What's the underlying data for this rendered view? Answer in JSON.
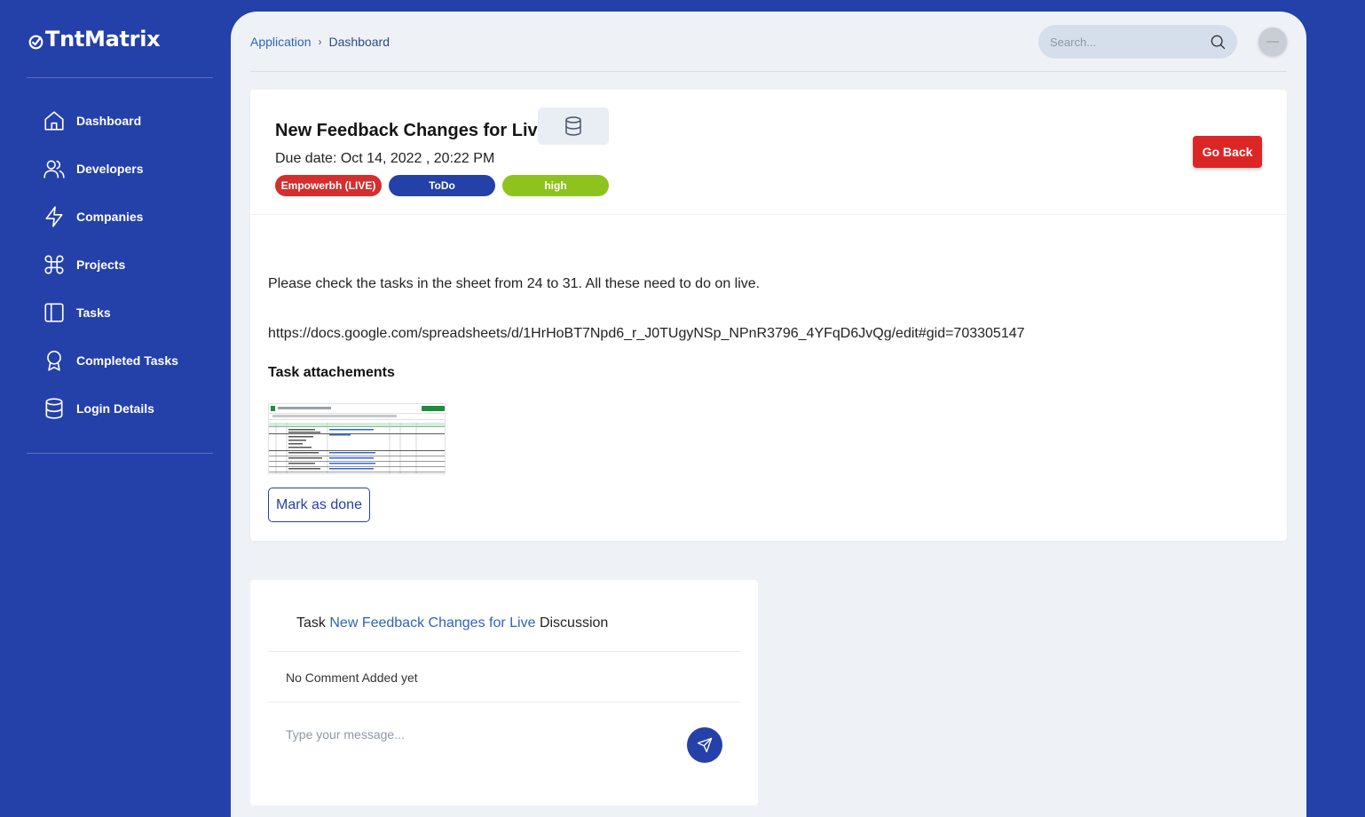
{
  "app": {
    "name": "TntMatrix"
  },
  "sidebar": {
    "items": [
      {
        "label": "Dashboard",
        "icon": "home-icon"
      },
      {
        "label": "Developers",
        "icon": "users-icon"
      },
      {
        "label": "Companies",
        "icon": "lightning-icon"
      },
      {
        "label": "Projects",
        "icon": "command-icon"
      },
      {
        "label": "Tasks",
        "icon": "columns-icon"
      },
      {
        "label": "Completed Tasks",
        "icon": "award-icon"
      },
      {
        "label": "Login Details",
        "icon": "database-icon"
      }
    ]
  },
  "header": {
    "breadcrumb": {
      "root": "Application",
      "separator": "›",
      "current": "Dashboard"
    },
    "search": {
      "placeholder": "Search..."
    }
  },
  "task": {
    "title": "New Feedback Changes for Live",
    "due_date": "Due date: Oct 14, 2022 , 20:22 PM",
    "badges": {
      "project": "Empowerbh (LIVE)",
      "status": "ToDo",
      "priority": "high"
    },
    "go_back_label": "Go Back",
    "description": "Please check the tasks in the sheet from 24 to 31. All these need to do on live.",
    "link": "https://docs.google.com/spreadsheets/d/1HrHoBT7Npd6_r_J0TUgyNSp_NPnR3796_4YFqD6JvQg/edit#gid=703305147",
    "attachments_title": "Task attachements",
    "mark_done_label": "Mark as done"
  },
  "discussion": {
    "prefix": "Task",
    "task_name": "New Feedback Changes for Live",
    "suffix": "Discussion",
    "empty_text": "No Comment Added yet",
    "message_placeholder": "Type your message..."
  },
  "colors": {
    "sidebar_bg": "#2440a9",
    "main_bg": "#eef2f7",
    "badge_project": "#d62d2d",
    "badge_status": "#2440a9",
    "badge_priority": "#8ec31d",
    "go_back": "#dc2626",
    "link_blue": "#2f63b8"
  }
}
